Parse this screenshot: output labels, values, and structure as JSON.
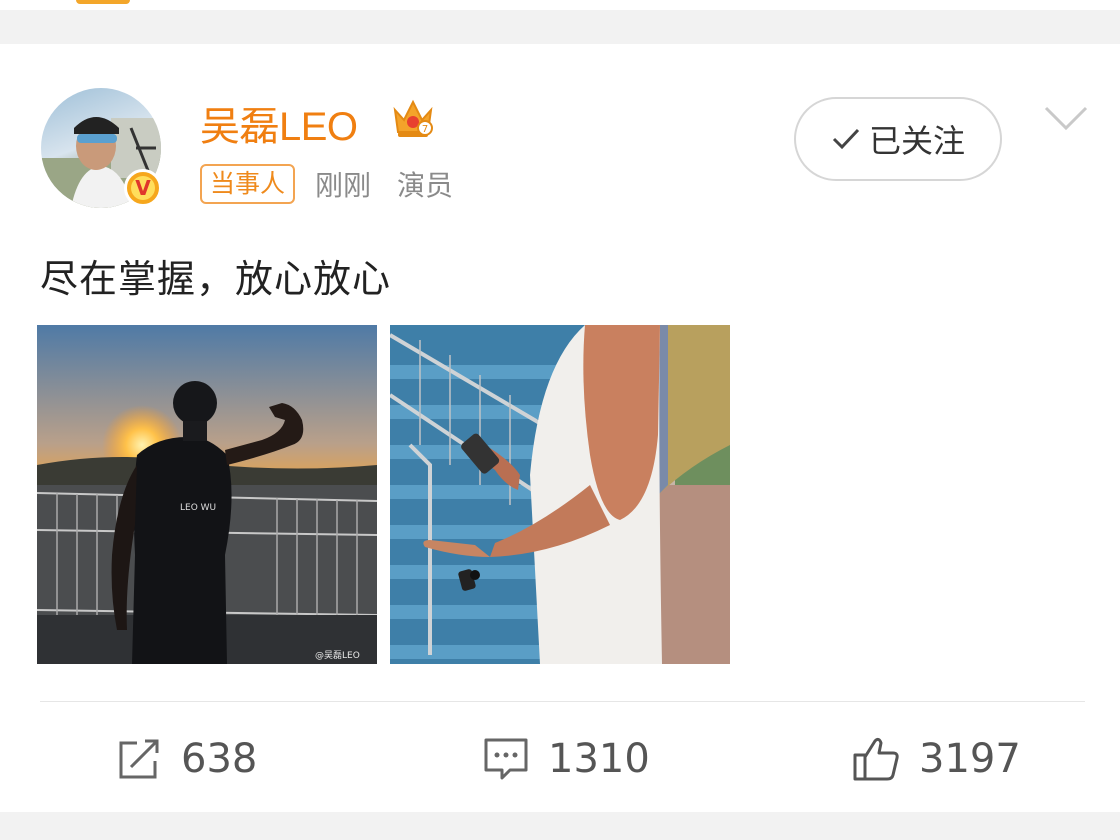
{
  "post": {
    "author": {
      "name": "吴磊LEO",
      "role_badge": "当事人",
      "time": "刚刚",
      "title": "演员",
      "verified_icon": "v-badge-icon",
      "crown_icon": "crown-icon"
    },
    "follow_button": {
      "label": "已关注",
      "icon": "check-icon"
    },
    "menu_icon": "chevron-down-icon",
    "text": "尽在掌握，放心放心",
    "images": [
      {
        "watermark": "@吴磊LEO",
        "shirt_text": "LEO WU"
      },
      {
        "watermark": ""
      }
    ],
    "actions": {
      "repost": {
        "count": "638",
        "icon": "repost-icon"
      },
      "comment": {
        "count": "1310",
        "icon": "comment-icon"
      },
      "like": {
        "count": "3197",
        "icon": "thumbs-up-icon"
      }
    }
  },
  "colors": {
    "brand_orange": "#f07f11",
    "badge_border": "#f3a451",
    "muted_text": "#8a8a8a",
    "page_bg": "#f2f2f2"
  }
}
